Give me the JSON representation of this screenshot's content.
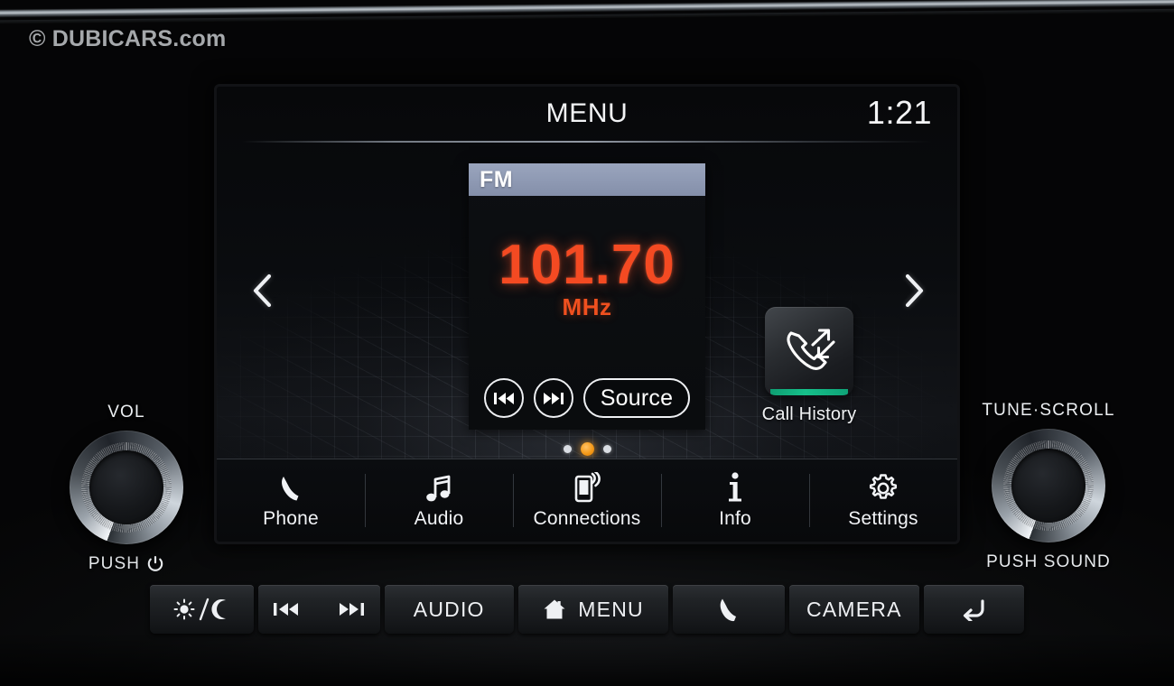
{
  "watermark": "© DUBICARS.com",
  "screen": {
    "status": {
      "title": "MENU",
      "clock": "1:21"
    },
    "carousel": {
      "prev_icon": "chevron-left-icon",
      "next_icon": "chevron-right-icon"
    },
    "radio_tile": {
      "band": "FM",
      "frequency": "101.70",
      "unit": "MHz",
      "frequency_color": "#f44a22",
      "header_color": "#8e99b3",
      "controls": [
        {
          "name": "previous-track-button",
          "icon": "previous-track-icon",
          "label": ""
        },
        {
          "name": "next-track-button",
          "icon": "next-track-icon",
          "label": ""
        },
        {
          "name": "source-button",
          "icon": "",
          "label": "Source"
        }
      ]
    },
    "shortcut": {
      "label": "Call History",
      "icon": "call-history-icon",
      "accent_color": "#16c08a"
    },
    "page_dots": {
      "count": 3,
      "active_index": 1,
      "active_color": "#f49a19"
    },
    "nav": [
      {
        "label": "Phone",
        "icon": "phone-icon"
      },
      {
        "label": "Audio",
        "icon": "music-note-icon"
      },
      {
        "label": "Connections",
        "icon": "phone-wireless-icon"
      },
      {
        "label": "Info",
        "icon": "info-icon"
      },
      {
        "label": "Settings",
        "icon": "gear-icon"
      }
    ]
  },
  "knobs": {
    "left": {
      "top_label": "VOL",
      "bottom_label": "PUSH",
      "bottom_icon": "power-icon"
    },
    "right": {
      "top_label": "TUNE·SCROLL",
      "bottom_label": "PUSH SOUND",
      "bottom_icon": ""
    }
  },
  "hard_buttons": [
    {
      "name": "day-night-button",
      "label": "",
      "icon": "day-night-icon"
    },
    {
      "name": "track-skip-buttons",
      "label": "",
      "icon": "prev-next-icons"
    },
    {
      "name": "audio-button",
      "label": "AUDIO",
      "icon": ""
    },
    {
      "name": "menu-button",
      "label": "MENU",
      "icon": "home-icon"
    },
    {
      "name": "phone-button",
      "label": "",
      "icon": "phone-icon"
    },
    {
      "name": "camera-button",
      "label": "CAMERA",
      "icon": ""
    },
    {
      "name": "back-button",
      "label": "",
      "icon": "back-arrow-icon"
    }
  ]
}
